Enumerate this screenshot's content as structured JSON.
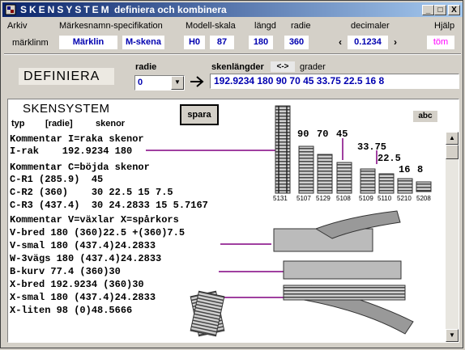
{
  "window": {
    "app_name": "SKENSYSTEM",
    "subtitle": "definiera och kombinera",
    "minimize": "_",
    "maximize": "□",
    "close": "X"
  },
  "menu": {
    "arkiv": "Arkiv",
    "markesnamn": "Märkesnamn-specifikation",
    "modellskala": "Modell-skala",
    "langd": "längd",
    "radie": "radie",
    "decimaler": "decimaler",
    "hjalp": "Hjälp"
  },
  "values": {
    "marklinm": "märklinm",
    "brand": "Märklin",
    "track": "M-skena",
    "scale": "H0",
    "scale_num": "87",
    "length": "180",
    "radius": "360",
    "prev": "‹",
    "decimal": "0.1234",
    "next": "›",
    "tom": "töm"
  },
  "define": {
    "title": "DEFINIERA",
    "radie_label": "radie",
    "radie_value": "0",
    "lengths_label": "skenlängder",
    "swap_label": "<->",
    "grader_label": "grader",
    "lengths_value": "192.9234 180 90 70 45 33.75 22.5 16 8"
  },
  "panel": {
    "title": "SKENSYSTEM",
    "col_typ": "typ",
    "col_radie": "[radie]",
    "col_skenor": "skenor",
    "save": "spara",
    "abc": "abc",
    "lines": [
      "Kommentar I=raka skenor",
      "I-rak    192.9234 180",
      "",
      "Kommentar C=böjda skenor",
      "C-R1 (285.9)  45",
      "C-R2 (360)    30 22.5 15 7.5",
      "C-R3 (437.4)  30 24.2833 15 5.7167",
      "Kommentar V=växlar X=spårkors",
      "V-bred 180 (360)22.5 +(360)7.5",
      "V-smal 180 (437.4)24.2833",
      "W-3vägs 180 (437.4)24.2833",
      "B-kurv 77.4 (360)30",
      "X-bred 192.9234 (360)30",
      "X-smal 180 (437.4)24.2833",
      "X-liten 98 (0)48.5666"
    ],
    "track_labels": [
      "90",
      "70",
      "45",
      "33.75",
      "22.5",
      "16",
      "8"
    ],
    "article_numbers": [
      "5131",
      "5107",
      "5129",
      "5108",
      "5109",
      "5110",
      "5210",
      "5208"
    ]
  },
  "colors": {
    "accent_text": "#0000b0",
    "connector": "#800080",
    "tom": "#ff00ff"
  }
}
